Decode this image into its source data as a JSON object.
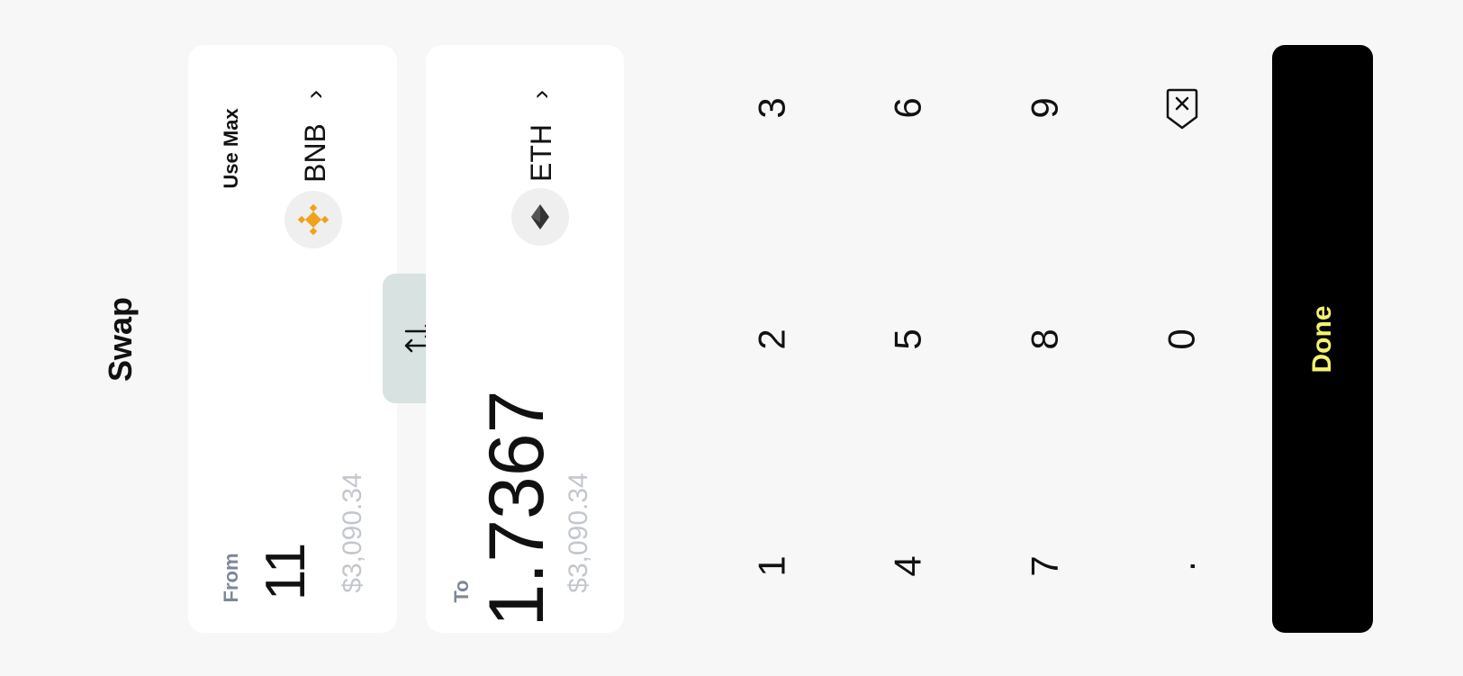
{
  "header": {
    "title": "Swap"
  },
  "from": {
    "label": "From",
    "amount": "11",
    "usd_value": "$3,090.34",
    "use_max_label": "Use Max",
    "token": {
      "symbol": "BNB",
      "icon": "bnb-logo-icon",
      "color": "#f0a21a"
    }
  },
  "to": {
    "label": "To",
    "amount": "1.7367",
    "usd_value": "$3,090.34",
    "token": {
      "symbol": "ETH",
      "icon": "eth-logo-icon",
      "color": "#333333"
    }
  },
  "switch_button": {
    "icon": "swap-arrows-icon"
  },
  "keypad": {
    "keys": [
      "1",
      "2",
      "3",
      "4",
      "5",
      "6",
      "7",
      "8",
      "9",
      ".",
      "0"
    ],
    "backspace_icon": "backspace-icon"
  },
  "done_button": {
    "label": "Done",
    "background": "#000000",
    "text_color": "#f3f36c"
  },
  "colors": {
    "background": "#f7f7f7",
    "card": "#ffffff",
    "switch_bg": "#d7e2e1",
    "label": "#7d8699",
    "usd": "#c3c6cd"
  }
}
